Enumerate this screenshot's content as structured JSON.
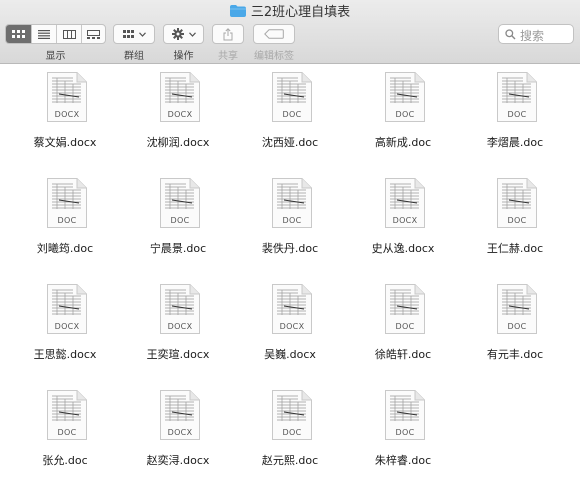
{
  "window": {
    "title": "三2班心理自填表"
  },
  "toolbar": {
    "view_label": "显示",
    "group_label": "群组",
    "action_label": "操作",
    "share_label": "共享",
    "tags_label": "编辑标签",
    "search_placeholder": "搜索"
  },
  "files": [
    {
      "name": "蔡文娟.docx",
      "ext": "DOCX"
    },
    {
      "name": "沈柳润.docx",
      "ext": "DOCX"
    },
    {
      "name": "沈西娅.doc",
      "ext": "DOC"
    },
    {
      "name": "高新成.doc",
      "ext": "DOC"
    },
    {
      "name": "李熠晨.doc",
      "ext": "DOC"
    },
    {
      "name": "刘曦筠.doc",
      "ext": "DOC"
    },
    {
      "name": "宁晨景.doc",
      "ext": "DOC"
    },
    {
      "name": "裴佚丹.doc",
      "ext": "DOC"
    },
    {
      "name": "史从逸.docx",
      "ext": "DOCX"
    },
    {
      "name": "王仁赫.doc",
      "ext": "DOC"
    },
    {
      "name": "王思懿.docx",
      "ext": "DOCX"
    },
    {
      "name": "王奕瑄.docx",
      "ext": "DOCX"
    },
    {
      "name": "吴巍.docx",
      "ext": "DOCX"
    },
    {
      "name": "徐皓轩.doc",
      "ext": "DOC"
    },
    {
      "name": "有元丰.doc",
      "ext": "DOC"
    },
    {
      "name": "张允.doc",
      "ext": "DOC"
    },
    {
      "name": "赵奕浔.docx",
      "ext": "DOCX"
    },
    {
      "name": "赵元熙.doc",
      "ext": "DOC"
    },
    {
      "name": "朱梓睿.doc",
      "ext": "DOC"
    }
  ]
}
